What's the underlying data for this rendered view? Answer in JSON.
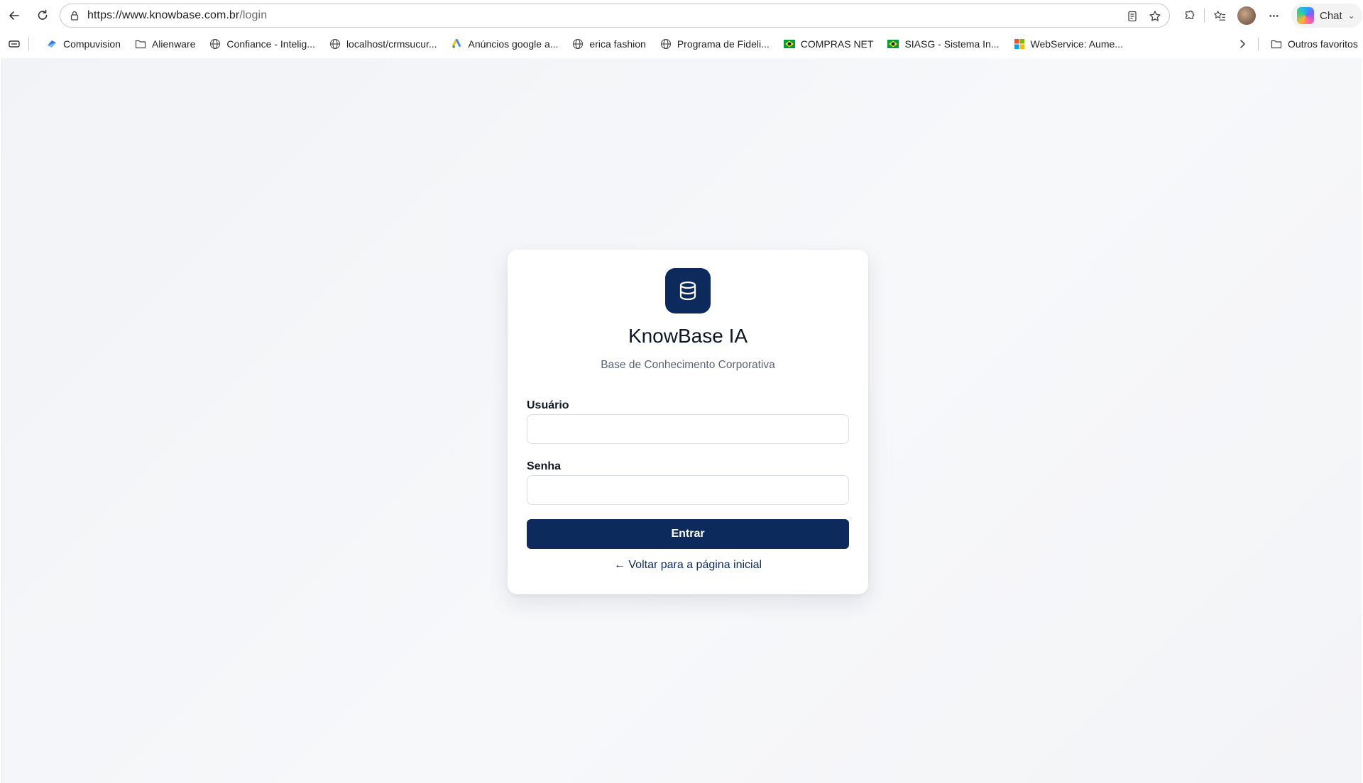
{
  "browser": {
    "url_host": "https://www.knowbase.com.br",
    "url_path": "/login",
    "chat_label": "Chat",
    "bookmarks": [
      {
        "label": "Compuvision",
        "icon": "compuvision-icon"
      },
      {
        "label": "Alienware",
        "icon": "folder-icon"
      },
      {
        "label": "Confiance - Intelig...",
        "icon": "globe-icon"
      },
      {
        "label": "localhost/crmsucur...",
        "icon": "globe-icon"
      },
      {
        "label": "Anúncios google a...",
        "icon": "google-ads-icon"
      },
      {
        "label": "erica fashion",
        "icon": "globe-icon"
      },
      {
        "label": "Programa de Fideli...",
        "icon": "globe-icon"
      },
      {
        "label": "COMPRAS NET",
        "icon": "brazil-flag-icon"
      },
      {
        "label": "SIASG - Sistema In...",
        "icon": "brazil-flag-icon"
      },
      {
        "label": "WebService: Aume...",
        "icon": "microsoft-icon"
      }
    ],
    "other_favorites": "Outros favoritos"
  },
  "login": {
    "app_name": "KnowBase IA",
    "subtitle": "Base de Conhecimento Corporativa",
    "username_label": "Usuário",
    "username_value": "",
    "password_label": "Senha",
    "password_value": "",
    "submit_label": "Entrar",
    "back_link": "← Voltar para a página inicial",
    "logo_icon": "database-icon",
    "brand_color": "#0d2a5c"
  }
}
